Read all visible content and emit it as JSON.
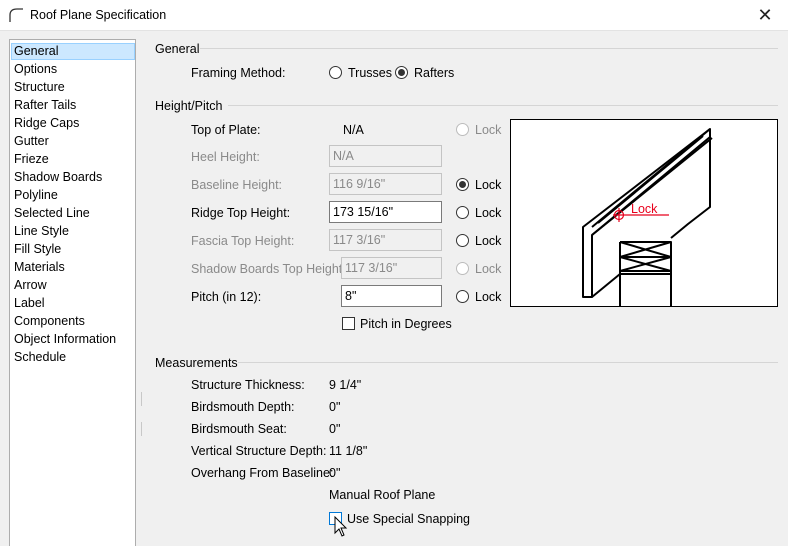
{
  "window": {
    "title": "Roof Plane Specification",
    "close_glyph": "✕",
    "icon": "roof-arc-icon"
  },
  "sidebar": {
    "selected": "General",
    "items": [
      "General",
      "Options",
      "Structure",
      "Rafter Tails",
      "Ridge Caps",
      "Gutter",
      "Frieze",
      "Shadow Boards",
      "Polyline",
      "Selected Line",
      "Line Style",
      "Fill Style",
      "Materials",
      "Arrow",
      "Label",
      "Components",
      "Object Information",
      "Schedule"
    ]
  },
  "general": {
    "heading": "General",
    "framing_label": "Framing Method:",
    "trusses_label": "Trusses",
    "rafters_label": "Rafters",
    "framing_selected": "Rafters"
  },
  "height": {
    "heading": "Height/Pitch",
    "top_of_plate_label": "Top of Plate:",
    "top_of_plate_value": "N/A",
    "heel_label": "Heel Height:",
    "heel_value": "N/A",
    "baseline_label": "Baseline Height:",
    "baseline_value": "116 9/16\"",
    "ridge_label": "Ridge Top Height:",
    "ridge_value": "173 15/16\"",
    "fascia_label": "Fascia Top Height:",
    "fascia_value": "117 3/16\"",
    "shadow_label": "Shadow Boards Top Height:",
    "shadow_value": "117 3/16\"",
    "pitch_label": "Pitch (in 12):",
    "pitch_value": "8\"",
    "lock_label": "Lock",
    "locked_row": "Baseline Height",
    "pitch_degrees_label": "Pitch in Degrees",
    "pitch_degrees_checked": false,
    "preview_lock_label": "Lock"
  },
  "measurements": {
    "heading": "Measurements",
    "thickness_label": "Structure Thickness:",
    "thickness_value": "9 1/4\"",
    "birdsmouth_depth_label": "Birdsmouth Depth:",
    "birdsmouth_depth_value": "0\"",
    "birdsmouth_seat_label": "Birdsmouth Seat:",
    "birdsmouth_seat_value": "0\"",
    "vertical_depth_label": "Vertical Structure Depth:",
    "vertical_depth_value": "11 1/8\"",
    "overhang_label": "Overhang From Baseline:",
    "overhang_value": "0\"",
    "manual_label": "Manual Roof Plane",
    "snapping_label": "Use Special Snapping",
    "snapping_checked": false
  },
  "colors": {
    "selection": "#cce8ff",
    "lock_marker": "#e8001c",
    "focus": "#0078d7"
  }
}
